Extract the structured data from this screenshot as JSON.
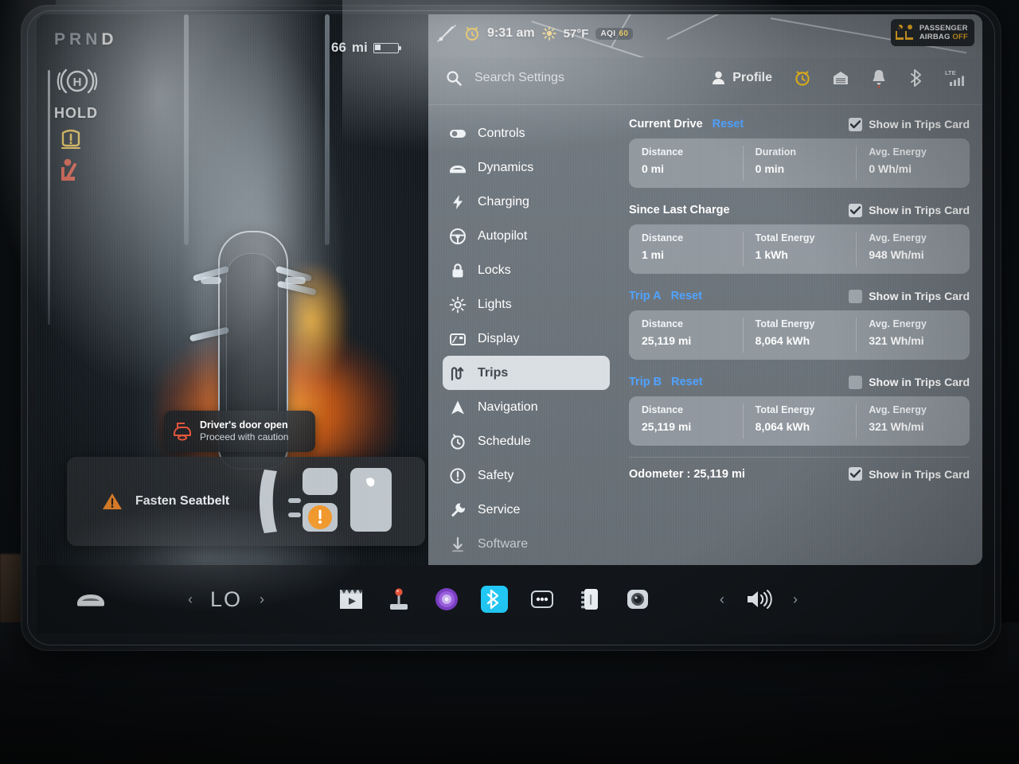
{
  "device": {
    "name": "Tesla Model 3 center touchscreen"
  },
  "drive_display": {
    "gear_indicator": {
      "letters": [
        "P",
        "R",
        "N"
      ],
      "active": "D"
    },
    "parking_brake_icon": "parking-brake-icon",
    "hold_label": "HOLD",
    "tpms_icon": "tire-pressure-warning-icon",
    "seatbelt_icon": "seatbelt-warning-icon",
    "range": {
      "value": "66",
      "unit": "mi"
    },
    "door_toast": {
      "icon": "car-door-open-icon",
      "title": "Driver's door open",
      "subtitle": "Proceed with caution"
    },
    "seatbelt_card": {
      "icon": "warning-triangle-icon",
      "label": "Fasten Seatbelt",
      "seatmap_icon": "seat-layout-diagram"
    }
  },
  "statusbar": {
    "wiper_icon": "wiper-off-icon",
    "alarm_icon": "alarm-clock-icon",
    "time": "9:31 am",
    "weather_icon": "sun-icon",
    "temperature": "57°F",
    "aqi": {
      "label": "AQI",
      "value": "60"
    },
    "airbag_badge": {
      "icon": "passenger-airbag-icon",
      "line1": "PASSENGER",
      "line2": "AIRBAG",
      "state": "OFF"
    }
  },
  "search": {
    "icon": "search-icon",
    "placeholder": "Search Settings",
    "value": ""
  },
  "topright": {
    "profile_label": "Profile",
    "icons": [
      {
        "name": "person-icon"
      },
      {
        "name": "alarm-clock-icon"
      },
      {
        "name": "garage-door-icon"
      },
      {
        "name": "bell-icon",
        "badge": true
      },
      {
        "name": "bluetooth-icon"
      },
      {
        "name": "lte-signal-icon",
        "label": "LTE"
      }
    ]
  },
  "sidebar": {
    "items": [
      {
        "label": "Controls",
        "icon": "toggle-switch-icon",
        "selected": false,
        "dim": false
      },
      {
        "label": "Dynamics",
        "icon": "car-front-icon",
        "selected": false,
        "dim": false
      },
      {
        "label": "Charging",
        "icon": "lightning-bolt-icon",
        "selected": false,
        "dim": false
      },
      {
        "label": "Autopilot",
        "icon": "steering-wheel-icon",
        "selected": false,
        "dim": false
      },
      {
        "label": "Locks",
        "icon": "padlock-icon",
        "selected": false,
        "dim": false
      },
      {
        "label": "Lights",
        "icon": "headlight-icon",
        "selected": false,
        "dim": false
      },
      {
        "label": "Display",
        "icon": "display-icon",
        "selected": false,
        "dim": false
      },
      {
        "label": "Trips",
        "icon": "trips-route-icon",
        "selected": true,
        "dim": false
      },
      {
        "label": "Navigation",
        "icon": "navigation-arrow-icon",
        "selected": false,
        "dim": false
      },
      {
        "label": "Schedule",
        "icon": "schedule-clock-icon",
        "selected": false,
        "dim": false
      },
      {
        "label": "Safety",
        "icon": "exclamation-circle-icon",
        "selected": false,
        "dim": false
      },
      {
        "label": "Service",
        "icon": "wrench-icon",
        "selected": false,
        "dim": false
      },
      {
        "label": "Software",
        "icon": "download-arrow-icon",
        "selected": false,
        "dim": true
      }
    ]
  },
  "trips": {
    "checkbox_label": "Show in Trips Card",
    "reset_label": "Reset",
    "sections": [
      {
        "title": "Current Drive",
        "title_is_link": false,
        "has_reset": true,
        "show_in_trips_card": true,
        "stats": [
          {
            "key": "Distance",
            "value": "0 mi"
          },
          {
            "key": "Duration",
            "value": "0 min"
          },
          {
            "key": "Avg. Energy",
            "value": "0 Wh/mi"
          }
        ]
      },
      {
        "title": "Since Last Charge",
        "title_is_link": false,
        "has_reset": false,
        "show_in_trips_card": true,
        "stats": [
          {
            "key": "Distance",
            "value": "1 mi"
          },
          {
            "key": "Total Energy",
            "value": "1 kWh"
          },
          {
            "key": "Avg. Energy",
            "value": "948 Wh/mi"
          }
        ]
      },
      {
        "title": "Trip A",
        "title_is_link": true,
        "has_reset": true,
        "show_in_trips_card": false,
        "stats": [
          {
            "key": "Distance",
            "value": "25,119 mi"
          },
          {
            "key": "Total Energy",
            "value": "8,064 kWh"
          },
          {
            "key": "Avg. Energy",
            "value": "321 Wh/mi"
          }
        ]
      },
      {
        "title": "Trip B",
        "title_is_link": true,
        "has_reset": true,
        "show_in_trips_card": false,
        "stats": [
          {
            "key": "Distance",
            "value": "25,119 mi"
          },
          {
            "key": "Total Energy",
            "value": "8,064 kWh"
          },
          {
            "key": "Avg. Energy",
            "value": "321 Wh/mi"
          }
        ]
      }
    ],
    "odometer": {
      "label": "Odometer : 25,119 mi",
      "show_in_trips_card": true
    }
  },
  "taskbar": {
    "car_icon": "car-front-icon",
    "climate": {
      "prev_icon": "chevron-left-icon",
      "temp": "LO",
      "next_icon": "chevron-right-icon"
    },
    "apps": [
      {
        "name": "theater-clapperboard-icon",
        "color": "#e8edf1"
      },
      {
        "name": "arcade-joystick-icon",
        "color": "#d9dfe4"
      },
      {
        "name": "tesla-tunes-icon",
        "color": "#8b4fd0"
      },
      {
        "name": "toybox-bluetooth-icon",
        "color": "#22c8f5"
      },
      {
        "name": "more-apps-icon",
        "color": "#cfd6dc"
      },
      {
        "name": "cards-icon",
        "color": "#eef2f5"
      },
      {
        "name": "dashcam-camera-icon",
        "color": "#cfd6dc"
      }
    ],
    "volume": {
      "prev_icon": "chevron-left-icon",
      "icon": "speaker-volume-icon",
      "next_icon": "chevron-right-icon"
    }
  },
  "colors": {
    "accent_blue": "#4ea2ff",
    "warning_amber": "#f5b324",
    "warning_red": "#e8563c",
    "panel_grey": "#767d84",
    "card_grey": "#9aa1a8"
  }
}
